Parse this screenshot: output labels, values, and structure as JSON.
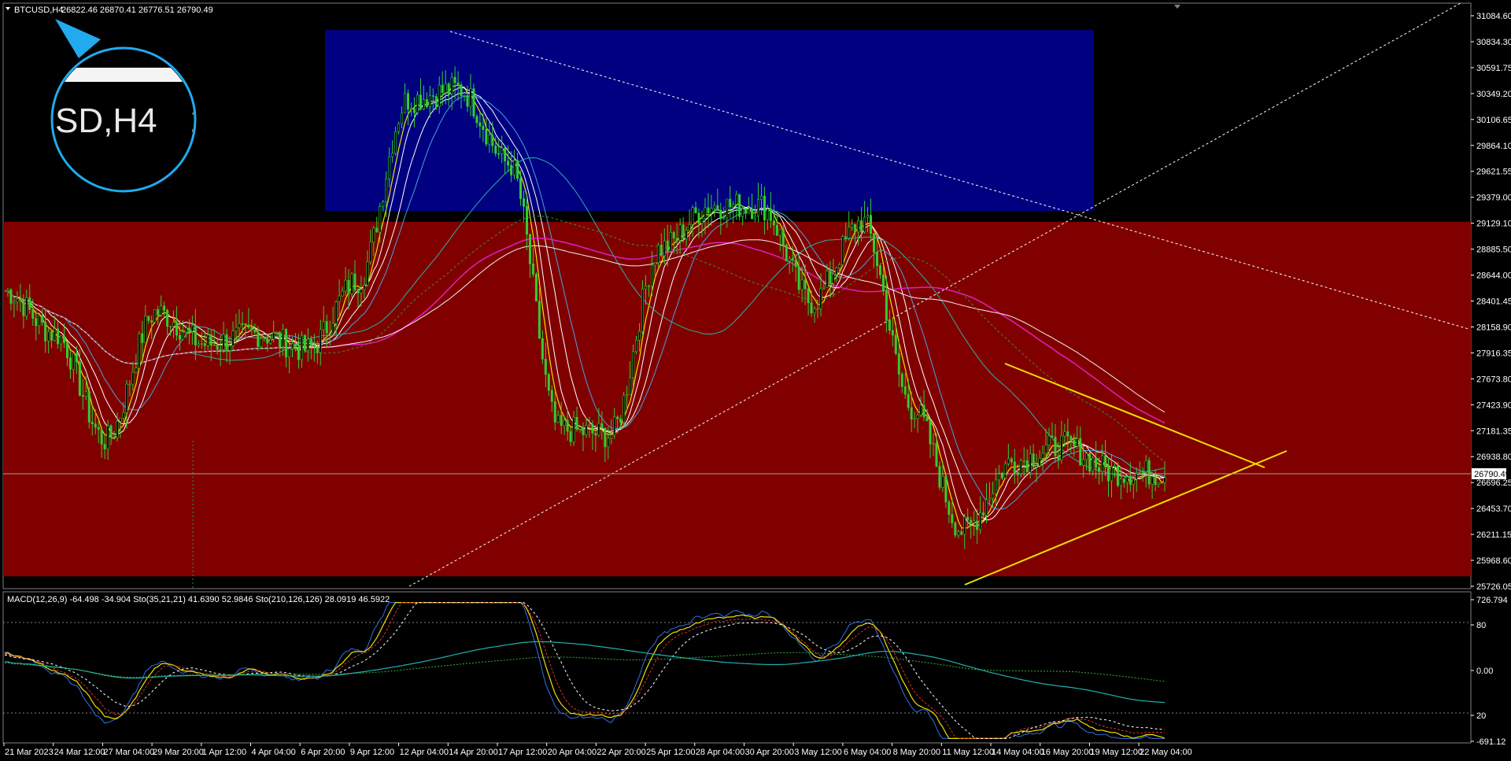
{
  "header": {
    "symbol": "BTCUSD,H4",
    "ohlc": "26822.46 26870.41 26776.51 26790.49"
  },
  "zoom_label": {
    "symbol": "SD,H4",
    "price_fragment": "26"
  },
  "price_axis": {
    "ticks": [
      "31084.60",
      "30834.30",
      "30591.75",
      "30349.20",
      "30106.65",
      "29864.10",
      "29621.55",
      "29379.00",
      "29129.10",
      "28885.50",
      "28644.00",
      "28401.45",
      "28158.90",
      "27916.35",
      "27673.80",
      "27423.90",
      "27181.35",
      "26938.80",
      "26696.25",
      "26453.70",
      "26211.15",
      "25968.60",
      "25726.05"
    ],
    "current": "26790.49"
  },
  "macd_panel": {
    "header": "MACD(12,26,9) -64.498 -34.904  Sto(35,21,21) 41.6390 52.9846  Sto(210,126,126) 28.0919 46.5922",
    "ticks": [
      "726.794",
      "80",
      "0.00",
      "20",
      "-691.12"
    ]
  },
  "time_axis": {
    "labels": [
      "21 Mar 2023",
      "24 Mar 12:00",
      "27 Mar 04:00",
      "29 Mar 20:00",
      "1 Apr 12:00",
      "4 Apr 04:00",
      "6 Apr 20:00",
      "9 Apr 12:00",
      "12 Apr 04:00",
      "14 Apr 20:00",
      "17 Apr 12:00",
      "20 Apr 04:00",
      "22 Apr 20:00",
      "25 Apr 12:00",
      "28 Apr 04:00",
      "30 Apr 20:00",
      "3 May 12:00",
      "6 May 04:00",
      "8 May 20:00",
      "11 May 12:00",
      "14 May 04:00",
      "16 May 20:00",
      "19 May 12:00",
      "22 May 04:00"
    ]
  },
  "colors": {
    "background": "#000000",
    "supply_zone": "#000080",
    "demand_zone": "#800000",
    "candle": "#32cd32",
    "triangle": "#f0e000",
    "ma_pink": "#e020c0",
    "zoom_ring": "#22aaee"
  },
  "chart_data": {
    "type": "line",
    "title": "BTCUSD,H4",
    "xlabel": "",
    "ylabel": "",
    "ylim": [
      25726.05,
      31084.6
    ],
    "x": [
      "21 Mar 2023",
      "24 Mar 12:00",
      "27 Mar 04:00",
      "29 Mar 20:00",
      "1 Apr 12:00",
      "4 Apr 04:00",
      "6 Apr 20:00",
      "9 Apr 12:00",
      "12 Apr 04:00",
      "14 Apr 20:00",
      "17 Apr 12:00",
      "20 Apr 04:00",
      "22 Apr 20:00",
      "25 Apr 12:00",
      "28 Apr 04:00",
      "30 Apr 20:00",
      "3 May 12:00",
      "6 May 04:00",
      "8 May 20:00",
      "11 May 12:00",
      "14 May 04:00",
      "16 May 20:00",
      "19 May 12:00",
      "22 May 04:00"
    ],
    "series": [
      {
        "values": [
          28500,
          28100,
          27100,
          28300,
          28000,
          28100,
          27950,
          28600,
          30300,
          30400,
          29700,
          27200,
          27150,
          28900,
          29300,
          29300,
          28400,
          29150,
          27400,
          26250,
          26900,
          27050,
          26800,
          26790
        ]
      }
    ],
    "zones": [
      {
        "color": "blue",
        "from": 29250,
        "to": 30950
      },
      {
        "color": "maroon",
        "from": 25820,
        "to": 29150
      }
    ],
    "current_price": 26790.49,
    "grid": false,
    "legend": "none"
  }
}
